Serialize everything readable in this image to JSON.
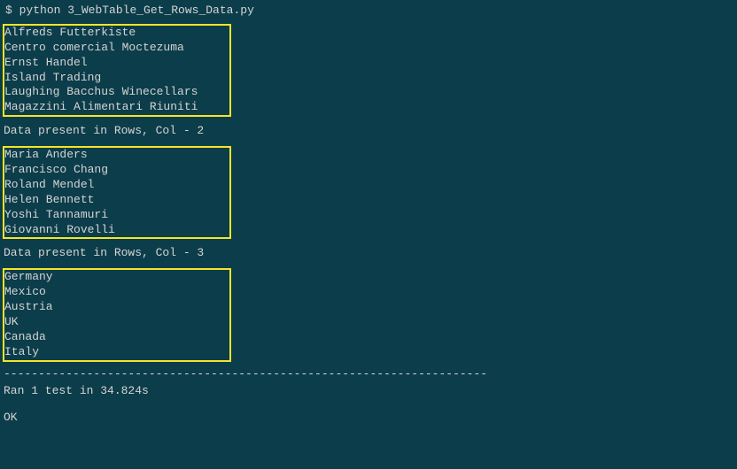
{
  "prompt": {
    "symbol": "$",
    "command": "python 3_WebTable_Get_Rows_Data.py"
  },
  "blocks": [
    {
      "lines": [
        "Alfreds Futterkiste",
        "Centro comercial Moctezuma",
        "Ernst Handel",
        "Island Trading",
        "Laughing Bacchus Winecellars",
        "Magazzini Alimentari Riuniti"
      ]
    },
    {
      "header": "Data present in Rows, Col - 2",
      "lines": [
        "Maria Anders",
        "Francisco Chang",
        "Roland Mendel",
        "Helen Bennett",
        "Yoshi Tannamuri",
        "Giovanni Rovelli"
      ]
    },
    {
      "header": "Data present in Rows, Col - 3",
      "lines": [
        "Germany",
        "Mexico",
        "Austria",
        "UK",
        "Canada",
        "Italy"
      ]
    }
  ],
  "divider": "----------------------------------------------------------------------",
  "result": "Ran 1 test in 34.824s",
  "status": "OK"
}
